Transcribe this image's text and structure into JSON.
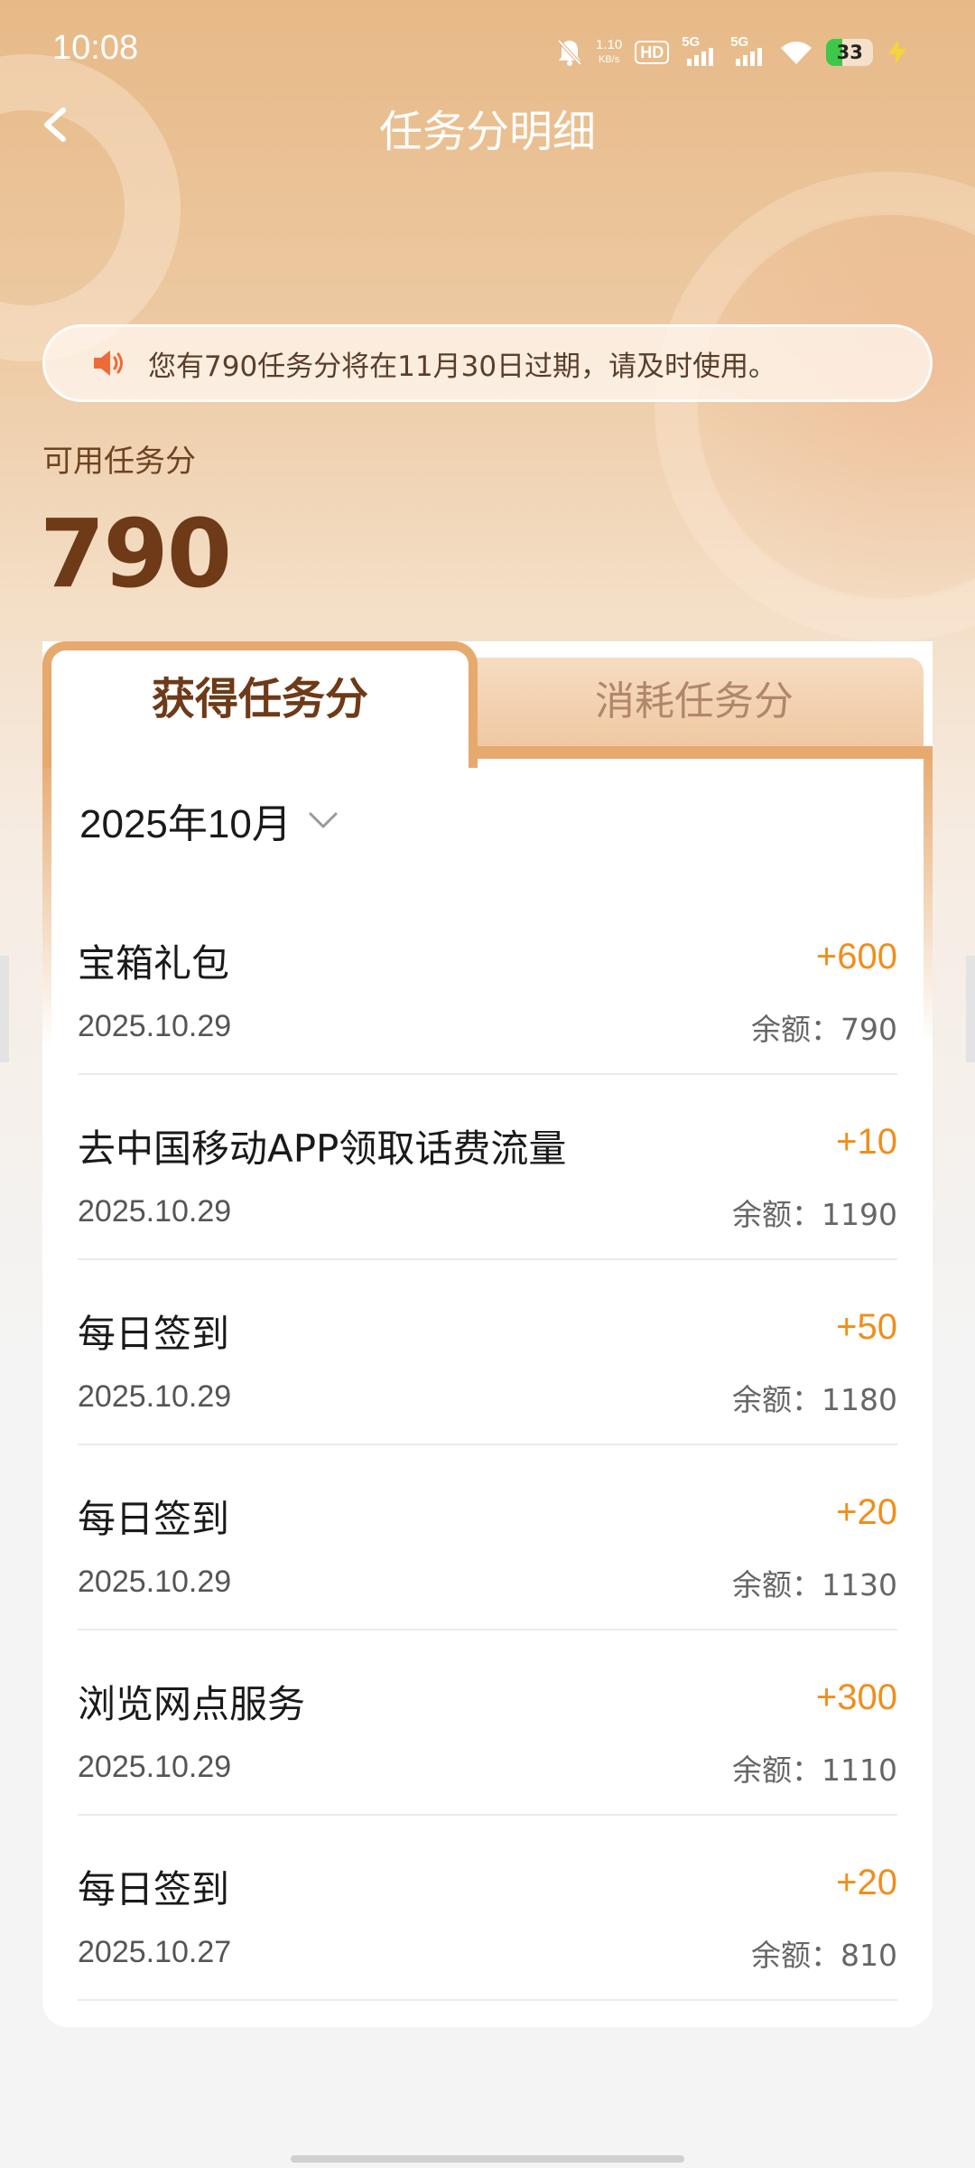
{
  "status_bar": {
    "time": "10:08",
    "net_speed_value": "1.10",
    "net_speed_unit": "KB/s",
    "hd_label": "HD",
    "signal1_label": "5G",
    "signal2_label": "5G",
    "battery_level": "33",
    "icons": [
      "mute-icon",
      "hd-icon",
      "signal-icon",
      "signal-icon",
      "wifi-icon",
      "battery-icon",
      "charging-icon"
    ]
  },
  "header": {
    "title": "任务分明细",
    "back_icon": "chevron-left-icon"
  },
  "notice": {
    "icon": "speaker-icon",
    "text": "您有790任务分将在11月30日过期，请及时使用。"
  },
  "balance": {
    "label": "可用任务分",
    "value": "790"
  },
  "tabs": {
    "earned": "获得任务分",
    "spent": "消耗任务分",
    "active": "earned"
  },
  "month_filter": {
    "value": "2025年10月",
    "icon": "chevron-down-icon"
  },
  "records": [
    {
      "title": "宝箱礼包",
      "date": "2025.10.29",
      "points": "+600",
      "balance": "余额：790"
    },
    {
      "title": "去中国移动APP领取话费流量",
      "date": "2025.10.29",
      "points": "+10",
      "balance": "余额：1190"
    },
    {
      "title": "每日签到",
      "date": "2025.10.29",
      "points": "+50",
      "balance": "余额：1180"
    },
    {
      "title": "每日签到",
      "date": "2025.10.29",
      "points": "+20",
      "balance": "余额：1130"
    },
    {
      "title": "浏览网点服务",
      "date": "2025.10.29",
      "points": "+300",
      "balance": "余额：1110"
    },
    {
      "title": "每日签到",
      "date": "2025.10.27",
      "points": "+20",
      "balance": "余额：810"
    }
  ],
  "colors": {
    "accent": "#ef8e1c",
    "brown": "#6e3a17",
    "tab_border": "#e6a96e"
  }
}
